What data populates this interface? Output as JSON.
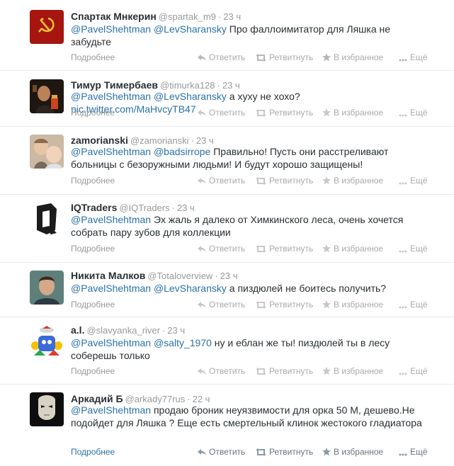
{
  "action_labels": {
    "expand": "Подробнее",
    "reply": "Ответить",
    "retweet": "Ретвитнуть",
    "favorite": "В избранное",
    "more": "Ещё"
  },
  "tweets": [
    {
      "name": "Спартак Мнкерин",
      "handle": "@spartak_m9",
      "time": "23 ч",
      "mention_1": "@PavelShehtman",
      "mention_2": "@LevSharansky",
      "text": " Про фаллоимитатор для Ляшка не забудьте",
      "avatar_icon": "hammer-sickle-flag-avatar"
    },
    {
      "name": "Тимур Тимербаев",
      "handle": "@timurka128",
      "time": "23 ч",
      "mention_1": "@PavelShehtman",
      "mention_2": "@LevSharansky",
      "text": " а хуху не хохо? ",
      "link": "pic.twitter.com/MaHvcyTB47",
      "avatar_icon": "portrait-avatar"
    },
    {
      "name": "zamorianski",
      "handle": "@zamorianski",
      "time": "23 ч",
      "mention_1": "@PavelShehtman",
      "mention_2": "@badsirrope",
      "text": " Правильно! Пусть они расстреливают больницы с безоружными людьми! И будут хорошо защищены!",
      "avatar_icon": "children-photo-avatar"
    },
    {
      "name": "IQTraders",
      "handle": "@IQTraders",
      "time": "23 ч",
      "mention_1": "@PavelShehtman",
      "text": " Эх жаль я далеко от Химкинского леса, очень хочется собрать пару зубов для коллекции",
      "avatar_icon": "iq-logo-avatar"
    },
    {
      "name": "Никита Малков",
      "handle": "@Totaloverview",
      "time": "23 ч",
      "mention_1": "@PavelShehtman",
      "mention_2": "@LevSharansky",
      "text": " а пиздюлей не боитесь получить?",
      "avatar_icon": "man-photo-avatar"
    },
    {
      "name": "a.l.",
      "handle": "@slavyanka_river",
      "time": "23 ч",
      "mention_1": "@PavelShehtman",
      "mention_2": "@salty_1970",
      "text": " ну и еблан же ты! пиздюлей ты в лесу соберешь только",
      "avatar_icon": "cartoon-avatar"
    },
    {
      "name": "Аркадий Б",
      "handle": "@arkady77rus",
      "time": "22 ч",
      "mention_1": "@PavelShehtman",
      "text": " продаю броник неуязвимости для орка 50 М, дешево.Не подойдет для Ляшка ? Еще есть смертельный клинок жестокого гладиатора",
      "avatar_icon": "mask-avatar"
    }
  ]
}
